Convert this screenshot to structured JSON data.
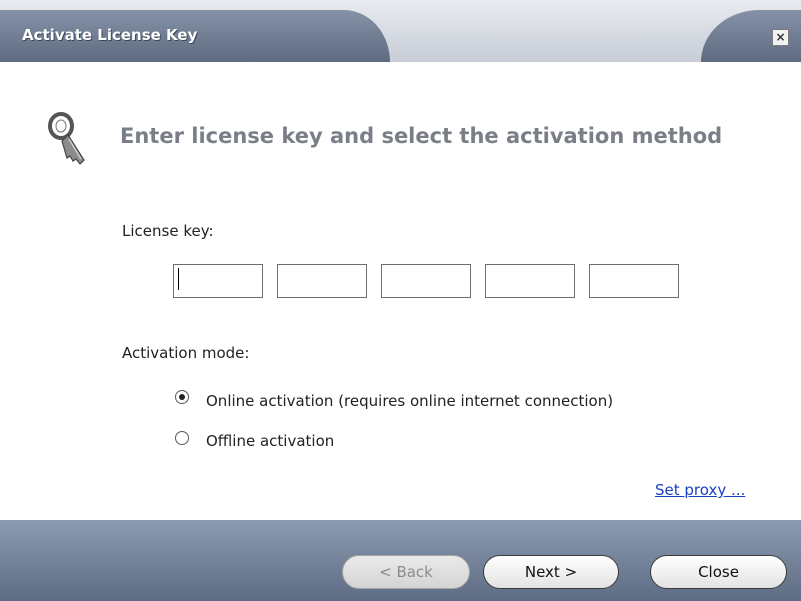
{
  "window": {
    "title": "Activate License Key",
    "close_glyph": "×"
  },
  "header": {
    "icon": "key-icon",
    "text": "Enter license key and select the activation method"
  },
  "license": {
    "label": "License key:",
    "fields": [
      "",
      "",
      "",
      "",
      ""
    ]
  },
  "activation": {
    "label": "Activation mode:",
    "options": [
      {
        "label": "Online activation (requires online internet connection)",
        "selected": true
      },
      {
        "label": "Offline activation",
        "selected": false
      }
    ]
  },
  "proxy_link": "Set proxy ...",
  "buttons": {
    "back": "< Back",
    "next": "Next >",
    "close": "Close"
  },
  "colors": {
    "title_bg": "#6f7b90",
    "footer_bg": "#76849b",
    "link": "#1a3fc0"
  }
}
